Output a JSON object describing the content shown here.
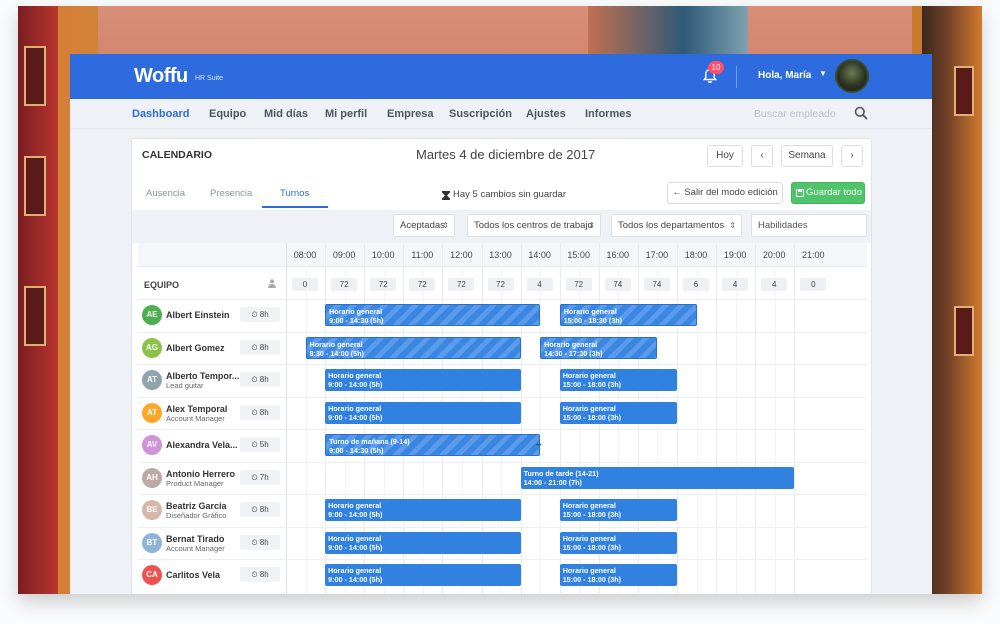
{
  "header": {
    "logo": "Woffu",
    "logo_sub": "HR Suite",
    "notif_count": "10",
    "greeting": "Hola, María"
  },
  "nav": {
    "items": [
      "Dashboard",
      "Equipo",
      "Mid días",
      "Mi perfil",
      "Empresa",
      "Suscripción",
      "Ajustes",
      "Informes"
    ],
    "search_placeholder": "Buscar empleado"
  },
  "calendar": {
    "title": "CALENDARIO",
    "date": "Martes 4 de diciembre de 2017",
    "btn_today": "Hoy",
    "btn_prev": "‹",
    "btn_week": "Semana",
    "btn_next": "›",
    "tabs": [
      "Ausencia",
      "Presencia",
      "Turnos"
    ],
    "unsaved": "Hay 5 cambios sin guardar",
    "btn_exit": "← Salir del modo edición",
    "btn_save": "Guardar todo"
  },
  "filters": {
    "status": "Aceptadas",
    "centers": "Todos los centros de trabajo",
    "departments": "Todos los departamentos",
    "skills": "Habilidades"
  },
  "grid": {
    "team_label": "EQUIPO",
    "hours": [
      "08:00",
      "09:00",
      "10:00",
      "11:00",
      "12:00",
      "13:00",
      "14:00",
      "15:00",
      "16:00",
      "17:00",
      "18:00",
      "19:00",
      "20:00",
      "21:00"
    ],
    "counts": [
      "0",
      "72",
      "72",
      "72",
      "72",
      "72",
      "4",
      "72",
      "74",
      "74",
      "6",
      "4",
      "4",
      "0"
    ]
  },
  "employees": [
    {
      "initials": "AE",
      "name": "Albert Einstein",
      "role": "",
      "hours": "8h",
      "color": "#4caf50"
    },
    {
      "initials": "AG",
      "name": "Albert Gomez",
      "role": "",
      "hours": "8h",
      "color": "#8bc34a"
    },
    {
      "initials": "AT",
      "name": "Alberto Tempor...",
      "role": "Lead guitar",
      "hours": "8h",
      "color": "#90a4ae"
    },
    {
      "initials": "AT",
      "name": "Alex Temporal",
      "role": "Account Manager",
      "hours": "8h",
      "color": "#ffa726"
    },
    {
      "initials": "AV",
      "name": "Alexandra Vela...",
      "role": "",
      "hours": "5h",
      "color": "#ce93d8"
    },
    {
      "initials": "AH",
      "name": "Antonio Herrero",
      "role": "Product Manager",
      "hours": "7h",
      "color": "#bcaaa4"
    },
    {
      "initials": "BE",
      "name": "Beatriz Garcia",
      "role": "Diseñador Gráfico",
      "hours": "8h",
      "color": "#d7b8a8"
    },
    {
      "initials": "BT",
      "name": "Bernat Tirado",
      "role": "Account Manager",
      "hours": "8h",
      "color": "#90b4d8"
    },
    {
      "initials": "CA",
      "name": "Carlitos Vela",
      "role": "",
      "hours": "8h",
      "color": "#ef5350"
    }
  ],
  "shifts": [
    {
      "row": 0,
      "start": 9.0,
      "end": 14.5,
      "title": "Horario general",
      "time": "9:00 - 14:30 (5h)",
      "striped": true
    },
    {
      "row": 0,
      "start": 15.0,
      "end": 18.5,
      "title": "Horario general",
      "time": "15:00 - 18:30 (3h)",
      "striped": true
    },
    {
      "row": 1,
      "start": 8.5,
      "end": 14.0,
      "title": "Horario general",
      "time": "8:30 - 14:00 (5h)",
      "striped": true
    },
    {
      "row": 1,
      "start": 14.5,
      "end": 17.5,
      "title": "Horario general",
      "time": "14:30 - 17:30 (3h)",
      "striped": true
    },
    {
      "row": 2,
      "start": 9.0,
      "end": 14.0,
      "title": "Horario general",
      "time": "9:00 - 14:00 (5h)",
      "striped": false
    },
    {
      "row": 2,
      "start": 15.0,
      "end": 18.0,
      "title": "Horario general",
      "time": "15:00 - 18:00 (3h)",
      "striped": false
    },
    {
      "row": 3,
      "start": 9.0,
      "end": 14.0,
      "title": "Horario general",
      "time": "9:00 - 14:00 (5h)",
      "striped": false
    },
    {
      "row": 3,
      "start": 15.0,
      "end": 18.0,
      "title": "Horario general",
      "time": "15:00 - 18:00 (3h)",
      "striped": false
    },
    {
      "row": 4,
      "start": 9.0,
      "end": 14.5,
      "title": "Turno de mañana (9-14)",
      "time": "9:00 - 14:30 (5h)",
      "striped": true
    },
    {
      "row": 5,
      "start": 14.0,
      "end": 21.0,
      "title": "Turno de tarde (14-21)",
      "time": "14:00 - 21:00 (7h)",
      "striped": false
    },
    {
      "row": 6,
      "start": 9.0,
      "end": 14.0,
      "title": "Horario general",
      "time": "9:00 - 14:00 (5h)",
      "striped": false
    },
    {
      "row": 6,
      "start": 15.0,
      "end": 18.0,
      "title": "Horario general",
      "time": "15:00 - 18:00 (3h)",
      "striped": false
    },
    {
      "row": 7,
      "start": 9.0,
      "end": 14.0,
      "title": "Horario general",
      "time": "9:00 - 14:00 (5h)",
      "striped": false
    },
    {
      "row": 7,
      "start": 15.0,
      "end": 18.0,
      "title": "Horario general",
      "time": "15:00 - 18:00 (3h)",
      "striped": false
    },
    {
      "row": 8,
      "start": 9.0,
      "end": 14.0,
      "title": "Horario general",
      "time": "9:00 - 14:00 (5h)",
      "striped": false
    },
    {
      "row": 8,
      "start": 15.0,
      "end": 18.0,
      "title": "Horario general",
      "time": "15:00 - 18:00 (3h)",
      "striped": false
    }
  ]
}
